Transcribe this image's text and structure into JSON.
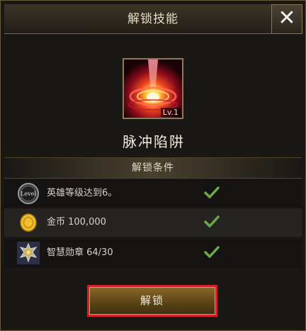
{
  "dialog": {
    "title": "解锁技能",
    "close_glyph": "✕"
  },
  "skill": {
    "name": "脉冲陷阱",
    "level": "Lv.1"
  },
  "conditions": {
    "header": "解锁条件",
    "items": [
      {
        "icon": "level-badge-icon",
        "icon_text": "Level",
        "text": "英雄等级达到6。",
        "met": true
      },
      {
        "icon": "gold-coin-icon",
        "text": "金币  100,000",
        "met": true
      },
      {
        "icon": "wisdom-medal-icon",
        "text": "智慧勋章  64/30",
        "met": true
      }
    ]
  },
  "unlock_button": {
    "label": "解锁"
  },
  "colors": {
    "check": "#6fa84a",
    "button_border": "#d1202a",
    "accent_gold": "#c8a866"
  }
}
